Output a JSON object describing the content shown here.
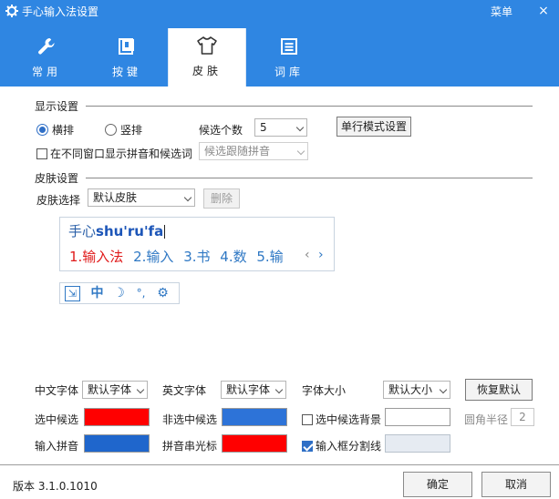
{
  "window": {
    "title": "手心输入法设置",
    "menu_label": "菜单",
    "close_glyph": "×"
  },
  "tabs": [
    {
      "label": "常用",
      "icon": "wrench-icon"
    },
    {
      "label": "按键",
      "icon": "keyboard-icon"
    },
    {
      "label": "皮肤",
      "icon": "tshirt-icon",
      "active": true
    },
    {
      "label": "词库",
      "icon": "list-icon"
    }
  ],
  "display": {
    "section_title": "显示设置",
    "layout_horizontal": "横排",
    "layout_vertical": "竖排",
    "selected_layout": "horizontal",
    "candidate_count_label": "候选个数",
    "candidate_count_value": "5",
    "single_line_button": "单行模式设置",
    "separate_window_label": "在不同窗口显示拼音和候选词",
    "separate_window_checked": false,
    "follow_pinyin_value": "候选跟随拼音"
  },
  "skin": {
    "section_title": "皮肤设置",
    "select_label": "皮肤选择",
    "select_value": "默认皮肤",
    "delete_button": "删除",
    "preview": {
      "composition_prefix": "手心",
      "composition_pinyin": "shu'ru'fa",
      "candidates": [
        "1.输入法",
        "2.输入",
        "3.书",
        "4.数",
        "5.输"
      ],
      "prev_glyph": "‹",
      "next_glyph": "›"
    },
    "toolbar": [
      {
        "icon": "skin-toggle-icon",
        "glyph": "⇲"
      },
      {
        "icon": "chinese-mode-icon",
        "glyph": "中"
      },
      {
        "icon": "half-width-moon-icon",
        "glyph": "☽"
      },
      {
        "icon": "punctuation-icon",
        "glyph": "°,"
      },
      {
        "icon": "gear-icon",
        "glyph": "⚙"
      }
    ]
  },
  "fonts": {
    "chinese_font_label": "中文字体",
    "chinese_font_value": "默认字体",
    "english_font_label": "英文字体",
    "english_font_value": "默认字体",
    "font_size_label": "字体大小",
    "font_size_value": "默认大小",
    "restore_button": "恢复默认"
  },
  "colors": {
    "selected_candidate_label": "选中候选",
    "selected_candidate_color": "#ff0000",
    "unselected_candidate_label": "非选中候选",
    "unselected_candidate_color": "#2d73d8",
    "selected_bg_label": "选中候选背景",
    "selected_bg_checked": false,
    "selected_bg_color": "#ffffff",
    "corner_radius_label": "圆角半径",
    "corner_radius_value": "2",
    "pinyin_label": "输入拼音",
    "pinyin_color": "#1f66cc",
    "cursor_label": "拼音串光标",
    "cursor_color": "#ff0000",
    "divider_label": "输入框分割线",
    "divider_checked": true,
    "divider_color": "#e6ebf2"
  },
  "footer": {
    "version": "版本 3.1.0.1010",
    "ok_button": "确定",
    "cancel_button": "取消"
  }
}
